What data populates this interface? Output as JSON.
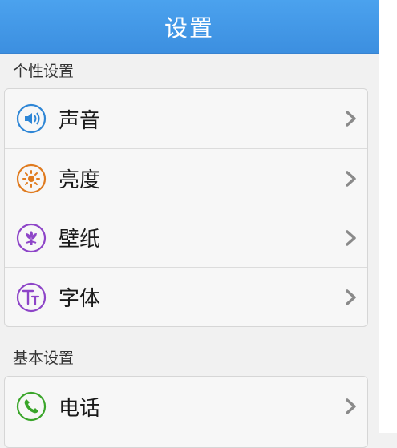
{
  "header": {
    "title": "设置"
  },
  "sections": [
    {
      "title": "个性设置",
      "items": [
        {
          "label": "声音",
          "icon": "speaker-icon",
          "color": "#2e86d6"
        },
        {
          "label": "亮度",
          "icon": "sun-icon",
          "color": "#e07b1f"
        },
        {
          "label": "壁纸",
          "icon": "flower-icon",
          "color": "#8e45c8"
        },
        {
          "label": "字体",
          "icon": "font-icon",
          "color": "#8e45c8"
        }
      ]
    },
    {
      "title": "基本设置",
      "items": [
        {
          "label": "电话",
          "icon": "phone-icon",
          "color": "#3aa52a"
        }
      ]
    }
  ]
}
